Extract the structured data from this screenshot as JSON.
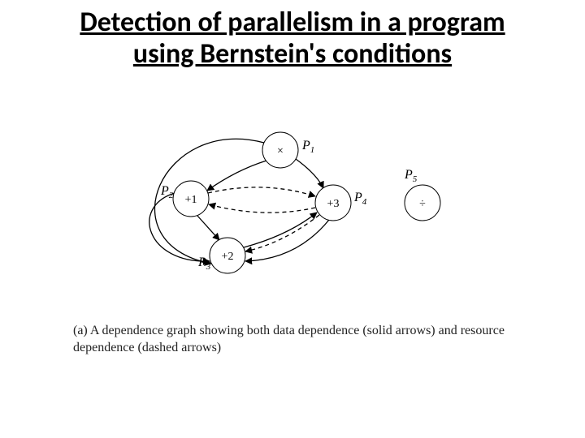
{
  "title_line1": "Detection of parallelism in a program",
  "title_line2": "using Bernstein's conditions",
  "nodes": {
    "p1": {
      "op": "×",
      "label": "P",
      "sub": "1"
    },
    "p2": {
      "op": "+1",
      "label": "P",
      "sub": "2"
    },
    "p3": {
      "op": "+2",
      "label": "P",
      "sub": "3"
    },
    "p4": {
      "op": "+3",
      "label": "P",
      "sub": "4"
    },
    "p5": {
      "op": "÷",
      "label": "P",
      "sub": "5"
    }
  },
  "caption_a": "(a) A dependence graph showing both data dependence (solid arrows) and resource dependence (dashed arrows)"
}
